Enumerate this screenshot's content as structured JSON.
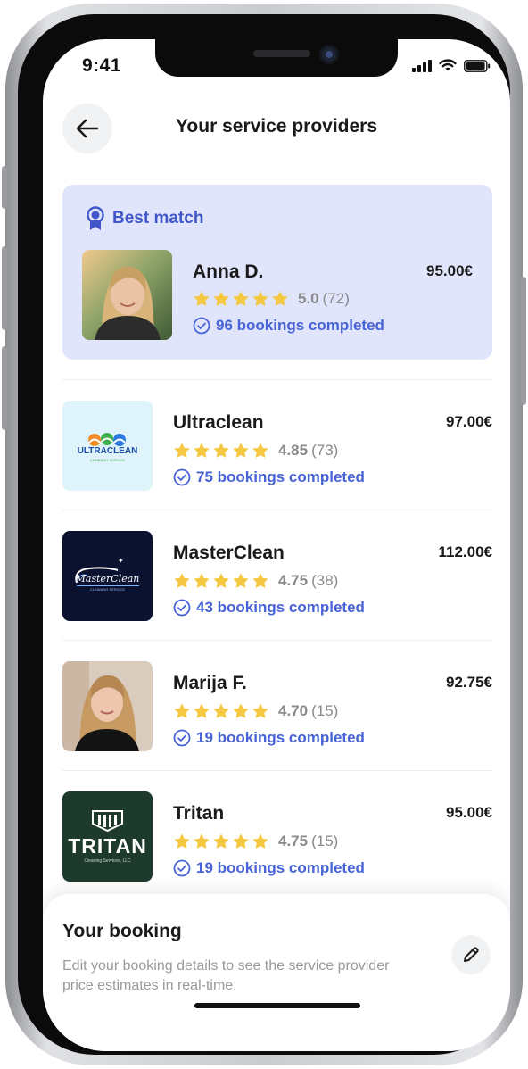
{
  "status_bar": {
    "time": "9:41"
  },
  "header": {
    "title": "Your service providers"
  },
  "best_match": {
    "label": "Best match",
    "name": "Anna D.",
    "price": "95.00€",
    "rating": "5.0",
    "reviews": "(72)",
    "bookings": "96 bookings completed"
  },
  "providers": [
    {
      "name": "Ultraclean",
      "price": "97.00€",
      "rating": "4.85",
      "reviews": "(73)",
      "bookings": "75 bookings completed",
      "logo_text": "ULTRACLEAN",
      "logo_sub": "CLEANING SERVICE"
    },
    {
      "name": "MasterClean",
      "price": "112.00€",
      "rating": "4.75",
      "reviews": "(38)",
      "bookings": "43 bookings completed",
      "logo_text": "MasterClean",
      "logo_sub": "CLEANING SERVICE"
    },
    {
      "name": "Marija F.",
      "price": "92.75€",
      "rating": "4.70",
      "reviews": "(15)",
      "bookings": "19 bookings completed"
    },
    {
      "name": "Tritan",
      "price": "95.00€",
      "rating": "4.75",
      "reviews": "(15)",
      "bookings": "19 bookings completed",
      "logo_text": "TRITAN",
      "logo_sub": "Cleaning Services, LLC"
    }
  ],
  "booking_sheet": {
    "title": "Your booking",
    "description": "Edit your booking details to see the service provider price estimates in real-time."
  },
  "colors": {
    "accent": "#4763d6",
    "best_match_bg": "#e1e5fc",
    "star": "#f5c842",
    "ultraclean_bg": "#dff3fb",
    "masterclean_bg": "#0b1230",
    "tritan_bg": "#1d3a2c"
  }
}
